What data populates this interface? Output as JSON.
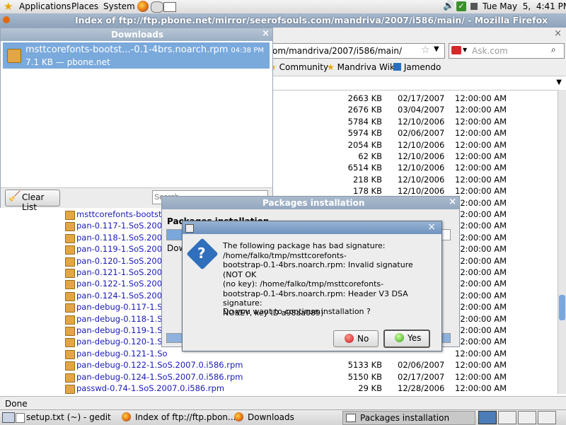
{
  "top_panel": {
    "menus": [
      "Applications",
      "Places",
      "System"
    ],
    "clock": "Tue May  5,  4:41 PM"
  },
  "firefox": {
    "title": "Index of ftp://ftp.pbone.net/mirror/seerofsouls.com/mandriva/2007/i586/main/ - Mozilla Firefox",
    "url": "om/mandriva/2007/i586/main/",
    "search_placeholder": "Ask.com",
    "bookmarks": [
      "Community",
      "Mandriva Wiki",
      "Jamendo"
    ],
    "status": "Done",
    "rows": [
      {
        "name": "",
        "size": "2663 KB",
        "date": "02/17/2007",
        "time": "12:00:00 AM"
      },
      {
        "name": "",
        "size": "2676 KB",
        "date": "03/04/2007",
        "time": "12:00:00 AM"
      },
      {
        "name": "",
        "size": "5784 KB",
        "date": "12/10/2006",
        "time": "12:00:00 AM"
      },
      {
        "name": "",
        "size": "5974 KB",
        "date": "02/06/2007",
        "time": "12:00:00 AM"
      },
      {
        "name": "",
        "size": "2054 KB",
        "date": "12/10/2006",
        "time": "12:00:00 AM"
      },
      {
        "name": "",
        "size": "62 KB",
        "date": "12/10/2006",
        "time": "12:00:00 AM"
      },
      {
        "name": "",
        "size": "6514 KB",
        "date": "12/10/2006",
        "time": "12:00:00 AM"
      },
      {
        "name": "",
        "size": "218 KB",
        "date": "12/10/2006",
        "time": "12:00:00 AM"
      },
      {
        "name": "",
        "size": "178 KB",
        "date": "12/10/2006",
        "time": "12:00:00 AM"
      },
      {
        "name": "",
        "size": "",
        "date": "",
        "time": "12:00:00 AM"
      },
      {
        "name": "msttcorefonts-bootst",
        "size": "",
        "date": "",
        "time": "12:00:00 AM"
      },
      {
        "name": "pan-0.117-1.SoS.2007.",
        "size": "",
        "date": "",
        "time": "12:00:00 AM"
      },
      {
        "name": "pan-0.118-1.SoS.2007.",
        "size": "",
        "date": "",
        "time": "12:00:00 AM"
      },
      {
        "name": "pan-0.119-1.SoS.2007.",
        "size": "",
        "date": "",
        "time": "12:00:00 AM"
      },
      {
        "name": "pan-0.120-1.SoS.2007.",
        "size": "",
        "date": "",
        "time": "12:00:00 AM"
      },
      {
        "name": "pan-0.121-1.SoS.2007.",
        "size": "",
        "date": "",
        "time": "12:00:00 AM"
      },
      {
        "name": "pan-0.122-1.SoS.2007.",
        "size": "",
        "date": "",
        "time": "12:00:00 AM"
      },
      {
        "name": "pan-0.124-1.SoS.2007.",
        "size": "",
        "date": "",
        "time": "12:00:00 AM"
      },
      {
        "name": "pan-debug-0.117-1.So",
        "size": "",
        "date": "",
        "time": "12:00:00 AM"
      },
      {
        "name": "pan-debug-0.118-1.So",
        "size": "",
        "date": "",
        "time": "12:00:00 AM"
      },
      {
        "name": "pan-debug-0.119-1.So",
        "size": "",
        "date": "",
        "time": "12:00:00 AM"
      },
      {
        "name": "pan-debug-0.120-1.So",
        "size": "",
        "date": "",
        "time": "12:00:00 AM"
      },
      {
        "name": "pan-debug-0.121-1.So",
        "size": "",
        "date": "",
        "time": "12:00:00 AM"
      },
      {
        "name": "pan-debug-0.122-1.SoS.2007.0.i586.rpm",
        "size": "5133 KB",
        "date": "02/06/2007",
        "time": "12:00:00 AM"
      },
      {
        "name": "pan-debug-0.124-1.SoS.2007.0.i586.rpm",
        "size": "5150 KB",
        "date": "02/17/2007",
        "time": "12:00:00 AM"
      },
      {
        "name": "passwd-0.74-1.SoS.2007.0.i586.rpm",
        "size": "29 KB",
        "date": "12/28/2006",
        "time": "12:00:00 AM"
      },
      {
        "name": "passwd-debug-0.74-1.SoS.2007.0.i586.rpm",
        "size": "1 KB",
        "date": "12/28/2006",
        "time": "12:00:00 AM"
      }
    ]
  },
  "downloads": {
    "title": "Downloads",
    "item_name": "msttcorefonts-bootst...-0.1-4brs.noarch.rpm",
    "item_time": "04:38 PM",
    "item_info": "7.1 KB — pbone.net",
    "clear_label": "Clear List",
    "search_placeholder": "Search..."
  },
  "packages": {
    "title": "Packages installation",
    "heading": "Packages installation",
    "sub": "Dow"
  },
  "dialog": {
    "message": "The following package has bad signature:\n/home/falko/tmp/msttcorefonts-\nbootstrap-0.1-4brs.noarch.rpm: Invalid signature (NOT OK\n(no key): /home/falko/tmp/msttcorefonts-\nbootstrap-0.1-4brs.noarch.rpm: Header V3 DSA signature:\nNOKEY, key ID a98aa089)",
    "question": "Do you want to continue installation ?",
    "no_label": "No",
    "yes_label": "Yes"
  },
  "taskbar": {
    "tasks": [
      "setup.txt (~) - gedit",
      "Index of ftp://ftp.pbon...",
      "Downloads",
      "Packages installation"
    ]
  }
}
